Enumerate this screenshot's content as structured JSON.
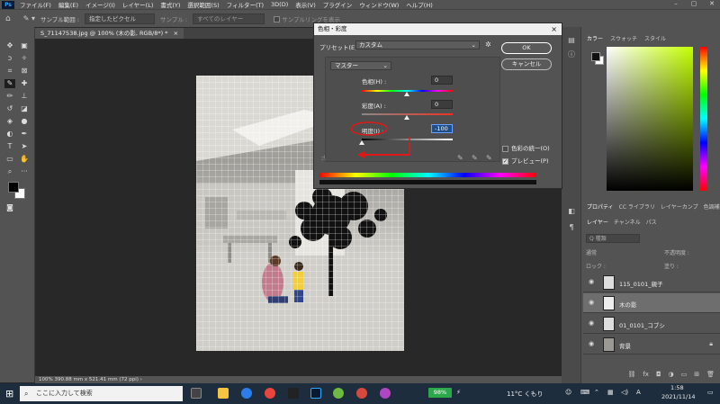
{
  "menubar": {
    "logo": "Ps",
    "items": [
      "ファイル(F)",
      "編集(E)",
      "イメージ(I)",
      "レイヤー(L)",
      "書式(Y)",
      "選択範囲(S)",
      "フィルター(T)",
      "3D(D)",
      "表示(V)",
      "プラグイン",
      "ウィンドウ(W)",
      "ヘルプ(H)"
    ]
  },
  "options": {
    "sample_range_label": "サンプル範囲 :",
    "sample_range_value": "指定したピクセル",
    "sample_label": "サンプル :",
    "sample_value": "すべてのレイヤー",
    "sampling_ring": "サンプルリングを表示"
  },
  "document": {
    "tab_title": "S_71147538.jpg @ 100% (木の影, RGB/8*) *",
    "tab_close": "×",
    "status": "100%   390.88 mm x 521.41 mm (72 ppi)   ›"
  },
  "color_panel": {
    "tabs": [
      "カラー",
      "スウォッチ",
      "スタイル"
    ]
  },
  "properties_tabs": [
    "プロパティ",
    "CC ライブラリ",
    "レイヤーカンプ",
    "色調補正"
  ],
  "layers_panel": {
    "tabs": [
      "レイヤー",
      "チャンネル",
      "パス"
    ],
    "search_placeholder": "Q 種類",
    "mode": "通常",
    "opacity_label": "不透明度 :",
    "lock_label": "ロック :",
    "fill_label": "塗り :",
    "layers": [
      {
        "name": "115_0101_親子",
        "selected": false,
        "locked": false
      },
      {
        "name": "木の影",
        "selected": true,
        "locked": false
      },
      {
        "name": "01_0101_コブシ",
        "selected": false,
        "locked": false
      },
      {
        "name": "背景",
        "selected": false,
        "locked": true
      }
    ]
  },
  "dialog": {
    "title": "色相・彩度",
    "close": "×",
    "preset_label": "プリセット(E) :",
    "preset_value": "カスタム",
    "ok_label": "OK",
    "cancel_label": "キャンセル",
    "channel": "マスター",
    "hue": {
      "label": "色相(H) :",
      "value": "0"
    },
    "saturation": {
      "label": "彩度(A) :",
      "value": "0"
    },
    "lightness": {
      "label": "明度(I) :",
      "value": "-100"
    },
    "colorize_label": "色彩の統一(O)",
    "colorize_checked": false,
    "preview_label": "プレビュー(P)",
    "preview_checked": true
  },
  "taskbar": {
    "search_placeholder": "ここに入力して検索",
    "battery": "98%",
    "weather": "11°C くもり",
    "ime": "A",
    "time": "1:58",
    "date": "2021/11/14"
  },
  "colors": {
    "accent_red": "#e01818",
    "selected_value": "#1d4f8a"
  }
}
